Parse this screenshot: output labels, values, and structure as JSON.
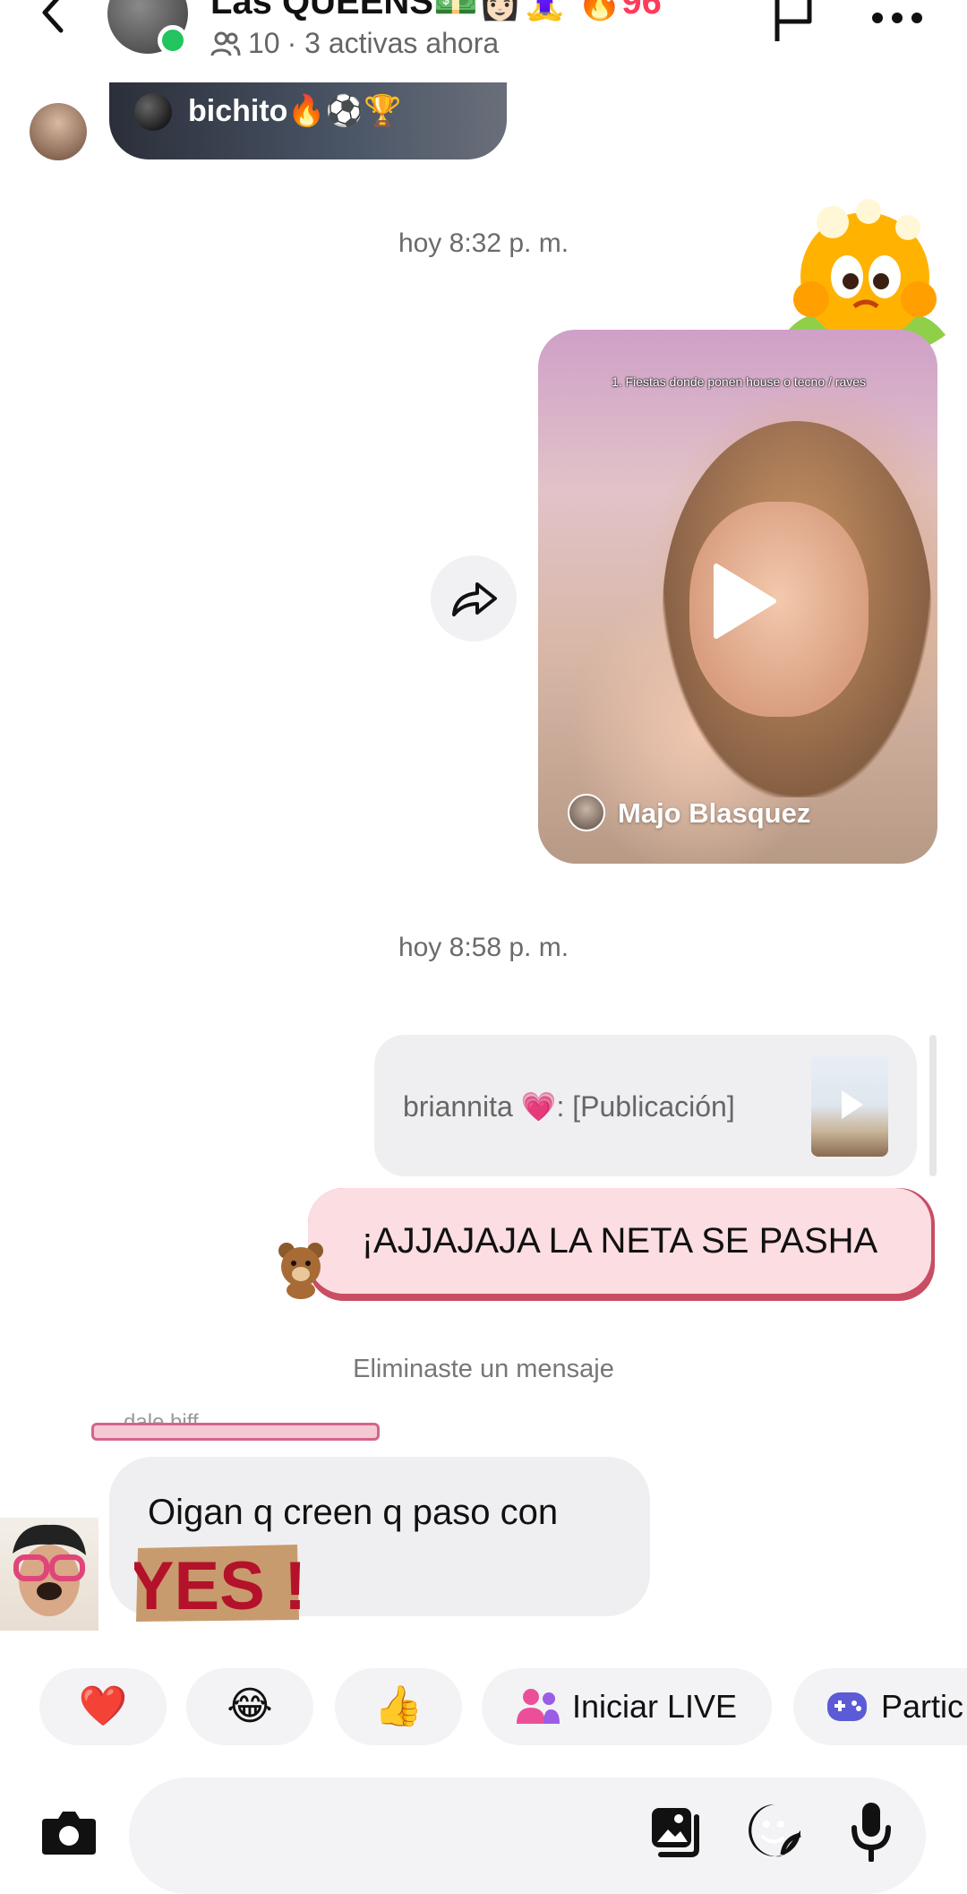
{
  "header": {
    "title": "Las QUEENS💵👩🏻🧘‍♀️",
    "streak": "🔥96",
    "member_count": "10",
    "status": "· 3 activas ahora"
  },
  "thread": {
    "forwarded_top": {
      "name": "bichito🔥⚽🏆"
    },
    "timestamp_1": "hoy 8:32 p. m.",
    "reel": {
      "caption": "1. Fiestas donde ponen house o tecno / raves",
      "author": "Majo Blasquez"
    },
    "timestamp_2": "hoy 8:58 p. m.",
    "reply_reference": "briannita 💗: [Publicación]",
    "sent_message": "¡AJJAJAJA LA NETA SE PASHA",
    "system_note": "Eliminaste un mensaje",
    "incoming": {
      "sender": "dale biff",
      "text": "Oigan q creen q paso con",
      "sticker_text": "YES !"
    }
  },
  "quick_actions": [
    {
      "emoji": "❤️"
    },
    {
      "emoji": "😂"
    },
    {
      "emoji": "👍"
    },
    {
      "label": "Iniciar LIVE"
    },
    {
      "label": "Partic"
    }
  ],
  "composer": {
    "placeholder": ""
  },
  "colors": {
    "online": "#22c55e",
    "sent_bubble": "#fbdde2",
    "sent_bubble_edge": "#c94d63",
    "received_bubble": "#efeff1",
    "live_icon": "#ec4f9a",
    "games_icon": "#5b5bd6"
  }
}
